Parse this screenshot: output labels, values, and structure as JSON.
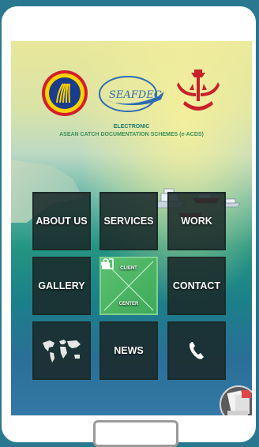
{
  "header": {
    "line1": "ELECTRONIC",
    "line2": "ASEAN CATCH DOCUMENTATION SCHEMES (e-ACDS)"
  },
  "logos": {
    "seafdec_text": "SEAFDEC"
  },
  "menu": {
    "about": "ABOUT US",
    "services": "SERVICES",
    "work": "WORK",
    "gallery": "GALLERY",
    "client_top": "CLIENT",
    "client_bottom": "CENTER",
    "contact": "CONTACT",
    "news": "NEWS"
  },
  "colors": {
    "frame": "#2a7890",
    "tile_dark": "#1a2828",
    "tile_green": "#4bb563",
    "heading": "#1c7a6c"
  }
}
